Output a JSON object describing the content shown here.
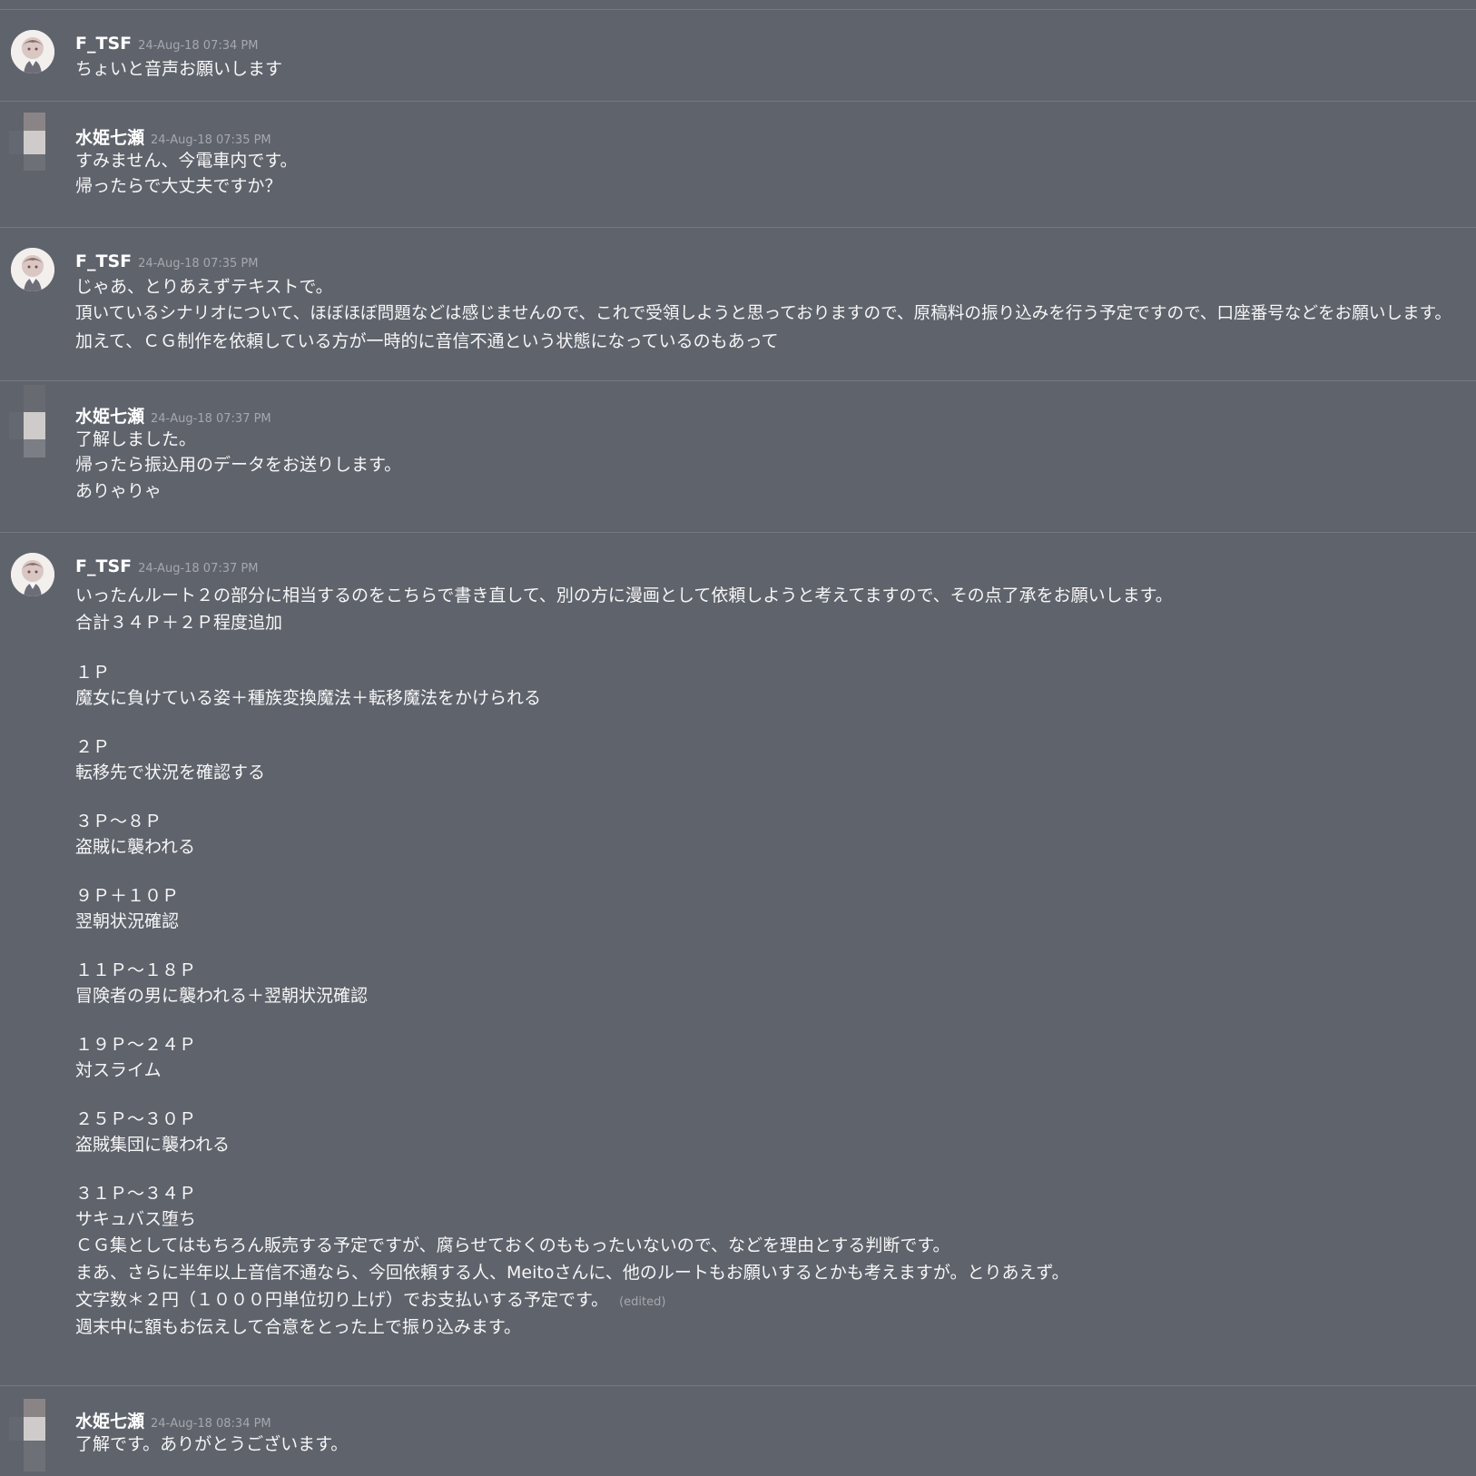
{
  "messages": [
    {
      "author": "F_TSF",
      "timestamp": "24-Aug-18 07:34 PM",
      "lines": [
        "ちょいと音声お願いします"
      ]
    },
    {
      "author": "水姫七瀬",
      "timestamp": "24-Aug-18 07:35 PM",
      "lines": [
        "すみません、今電車内です。",
        "帰ったらで大丈夫ですか？"
      ]
    },
    {
      "author": "F_TSF",
      "timestamp": "24-Aug-18 07:35 PM",
      "lines": [
        "じゃあ、とりあえずテキストで。",
        "頂いているシナリオについて、ほぼほぼ問題などは感じませんので、これで受領しようと思っておりますので、原稿料の振り込みを行う予定ですので、口座番号などをお願いします。",
        "加えて、ＣＧ制作を依頼している方が一時的に音信不通という状態になっているのもあって"
      ]
    },
    {
      "author": "水姫七瀬",
      "timestamp": "24-Aug-18 07:37 PM",
      "lines": [
        "了解しました。",
        "帰ったら振込用のデータをお送りします。",
        "ありゃりゃ"
      ]
    },
    {
      "author": "F_TSF",
      "timestamp": "24-Aug-18 07:37 PM",
      "lines": [
        "いったんルート２の部分に相当するのをこちらで書き直して、別の方に漫画として依頼しようと考えてますので、その点了承をお願いします。",
        "合計３４Ｐ＋２Ｐ程度追加",
        "",
        "１Ｐ",
        "魔女に負けている姿＋種族変換魔法＋転移魔法をかけられる",
        "",
        "２Ｐ",
        "転移先で状況を確認する",
        "",
        "３Ｐ～８Ｐ",
        "盗賊に襲われる",
        "",
        "９Ｐ＋１０Ｐ",
        "翌朝状況確認",
        "",
        "１１Ｐ～１８Ｐ",
        "冒険者の男に襲われる＋翌朝状況確認",
        "",
        "１９Ｐ～２４Ｐ",
        "対スライム",
        "",
        "２５Ｐ～３０Ｐ",
        "盗賊集団に襲われる",
        "",
        "３１Ｐ～３４Ｐ",
        "サキュバス堕ち",
        "ＣＧ集としてはもちろん販売する予定ですが、腐らせておくのももったいないので、などを理由とする判断です。",
        "まあ、さらに半年以上音信不通なら、今回依頼する人、Meitoさんに、他のルートもお願いするとかも考えますが。とりあえず。",
        "文字数＊２円（１０００円単位切り上げ）でお支払いする予定です。",
        "週末中に額もお伝えして合意をとった上で振り込みます。"
      ],
      "edited_label": "(edited)"
    },
    {
      "author": "水姫七瀬",
      "timestamp": "24-Aug-18 08:34 PM",
      "lines": [
        "了解です。ありがとうございます。"
      ]
    }
  ]
}
